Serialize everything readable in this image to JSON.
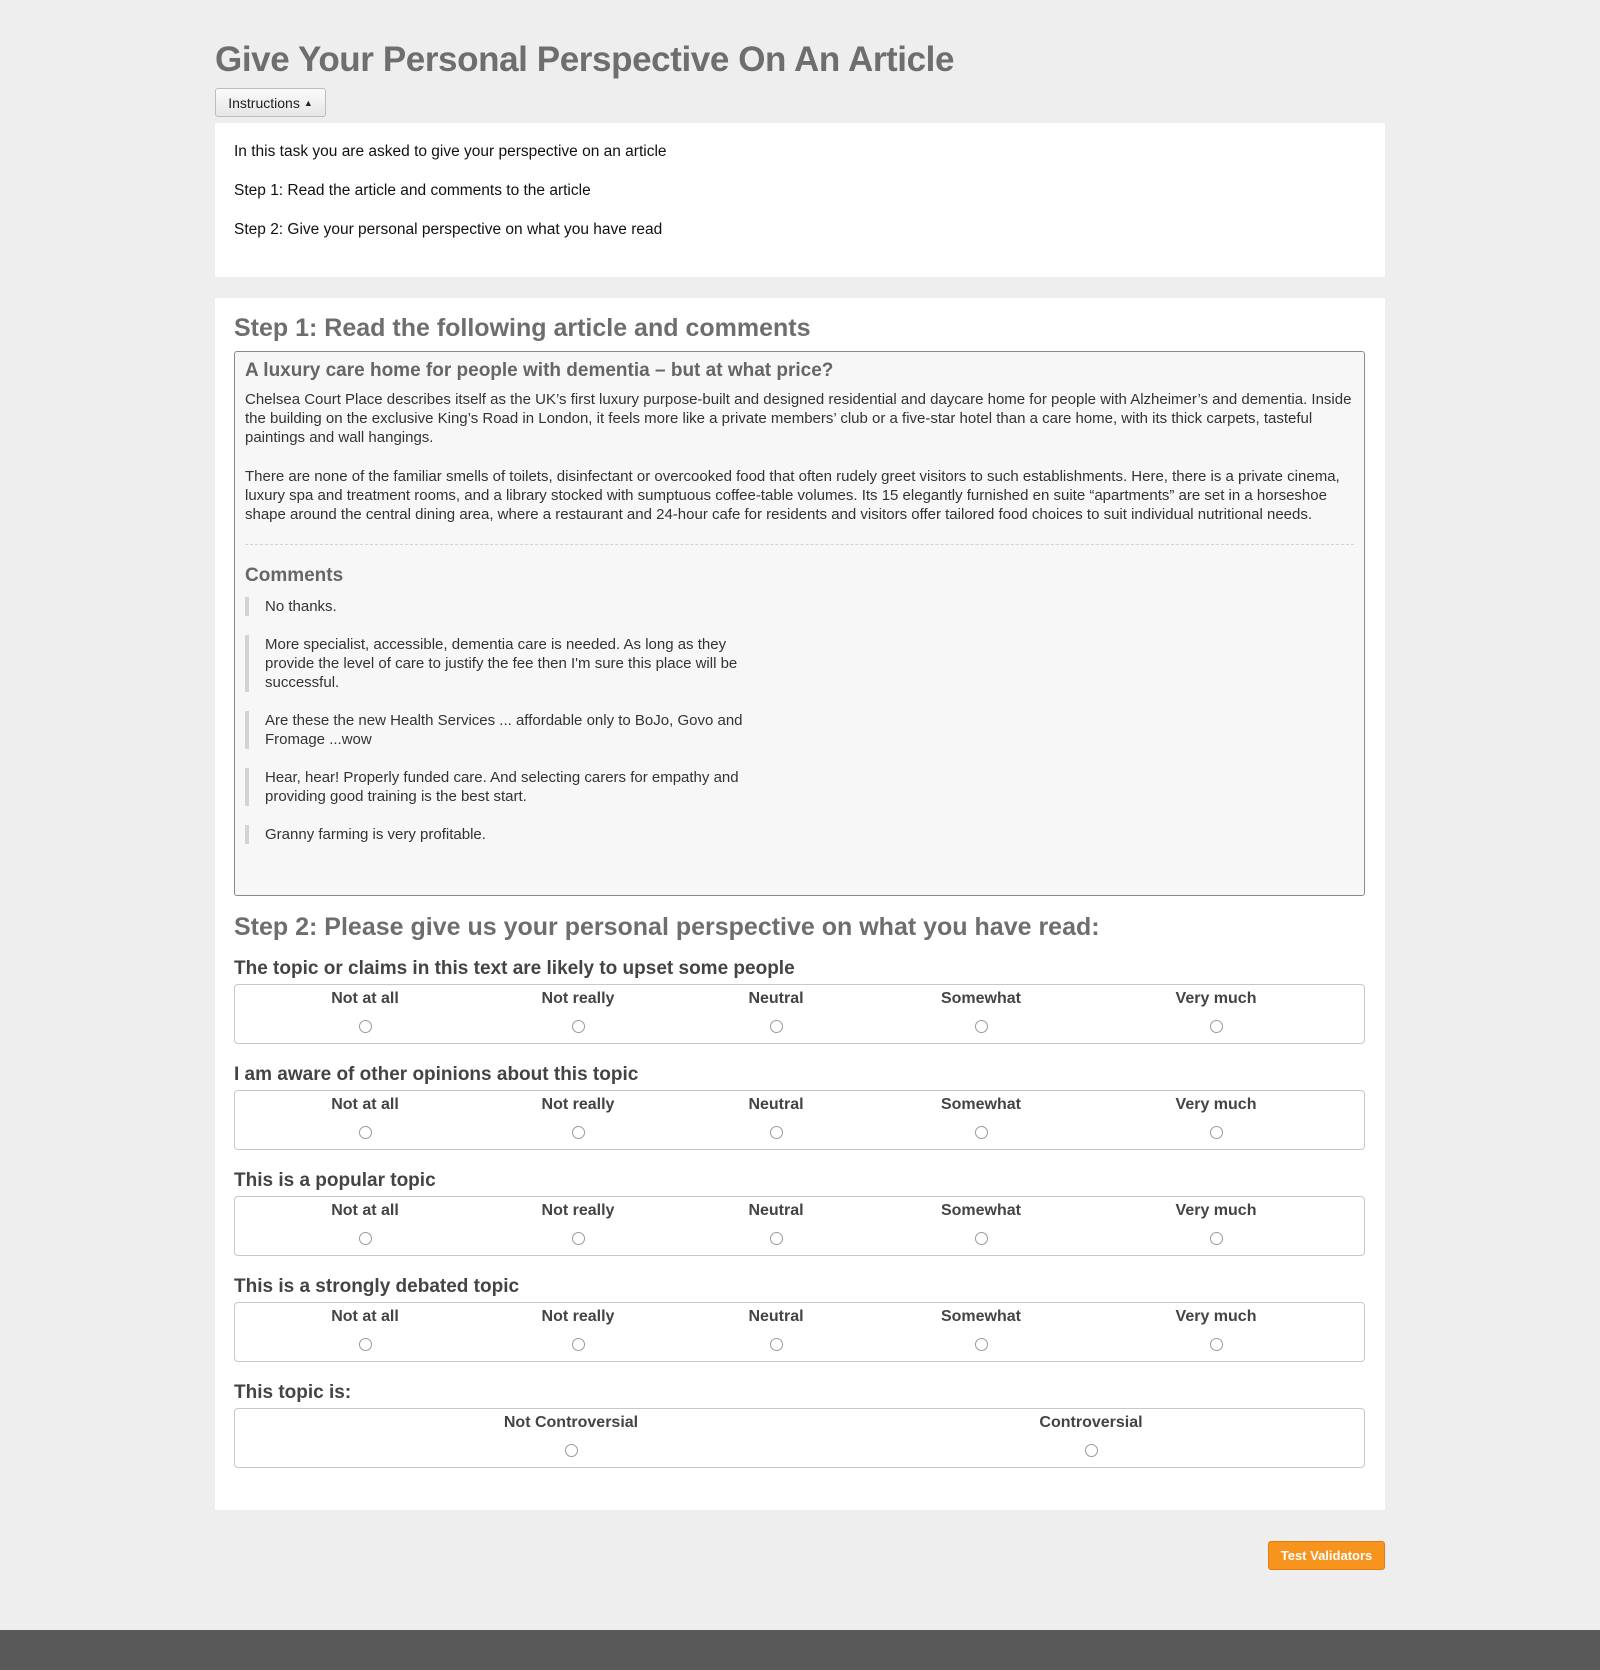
{
  "title": "Give Your Personal Perspective On An Article",
  "instructions_button": "Instructions",
  "instructions": [
    "In this task you are asked to give your perspective on an article",
    "Step 1: Read the article and comments to the article",
    "Step 2: Give your personal perspective on what you have read"
  ],
  "step1": {
    "heading": "Step 1: Read the following article and comments",
    "article_title": "A luxury care home for people with dementia – but at what price?",
    "paragraphs": [
      "Chelsea Court Place describes itself as the UK’s first luxury purpose-built and designed residential and daycare home for people with Alzheimer’s and dementia. Inside the building on the exclusive King’s Road in London, it feels more like a private members’ club or a five-star hotel than a care home, with its thick carpets, tasteful paintings and wall hangings.",
      "There are none of the familiar smells of toilets, disinfectant or overcooked food that often rudely greet visitors to such establishments. Here, there is a private cinema, luxury spa and treatment rooms, and a library stocked with sumptuous coffee-table volumes. Its 15 elegantly furnished en suite “apartments” are set in a horseshoe shape around the central dining area, where a restaurant and 24-hour cafe for residents and visitors offer tailored food choices to suit individual nutritional needs."
    ],
    "comments_heading": "Comments",
    "comments": [
      "No thanks.",
      "More specialist, accessible, dementia care is needed. As long as they provide the level of care to justify the fee then I'm sure this place will be successful.",
      "Are these the new Health Services ... affordable only to BoJo, Govo and Fromage ...wow",
      "Hear, hear! Properly funded care. And selecting carers for empathy and providing good training is the best start.",
      "Granny farming is very profitable."
    ]
  },
  "step2": {
    "heading": "Step 2: Please give us your personal perspective on what you have read:",
    "scale_options": [
      "Not at all",
      "Not really",
      "Neutral",
      "Somewhat",
      "Very much"
    ],
    "questions": [
      "The topic or claims in this text are likely to upset some people",
      "I am aware of other opinions about this topic",
      "This is a popular topic",
      "This is a strongly debated topic"
    ],
    "final_question": "This topic is:",
    "final_options": [
      "Not Controversial",
      "Controversial"
    ]
  },
  "test_button": "Test Validators"
}
